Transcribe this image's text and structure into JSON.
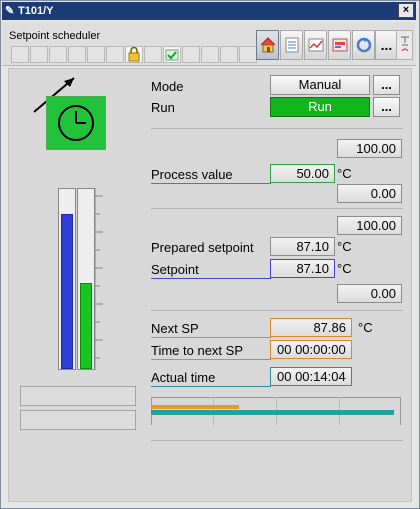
{
  "window": {
    "title": "T101/Y",
    "close_label": "×"
  },
  "panel": {
    "label": "Setpoint scheduler",
    "more_label": "..."
  },
  "operation": {
    "mode_label": "Mode",
    "mode_value": "Manual",
    "mode_more": "...",
    "run_label": "Run",
    "run_value": "Run",
    "run_more": "..."
  },
  "process": {
    "high_limit": "100.00",
    "pv_label": "Process value",
    "pv_value": "50.00",
    "pv_unit": "°C",
    "low_limit": "0.00"
  },
  "setpoints": {
    "high_limit": "100.00",
    "prepared_label": "Prepared setpoint",
    "prepared_value": "87.10",
    "prepared_unit": "°C",
    "sp_label": "Setpoint",
    "sp_value": "87.10",
    "sp_unit": "°C",
    "low_limit": "0.00"
  },
  "schedule": {
    "next_sp_label": "Next SP",
    "next_sp_value": "87.86",
    "next_sp_unit": "°C",
    "time_next_label": "Time to next SP",
    "time_next_value": "00  00:00:00",
    "actual_label": "Actual time",
    "actual_value": "00  00:14:04",
    "progress_orange": 0.35,
    "progress_teal": 0.97
  },
  "bars": {
    "blue_level": 0.86,
    "green_level": 0.48
  },
  "colors": {
    "pv": "#2e9e45",
    "sp": "#3a48d4",
    "next_sp": "#d48a2c",
    "actual": "#2e8b9a",
    "run": "#12b51c",
    "clock_bg": "#22c33a",
    "bar_blue": "#2f3fd6",
    "bar_green": "#19c51f"
  },
  "icons": [
    "pen-icon",
    "lock-icon",
    "checkmark-icon",
    "home-icon",
    "checklist-icon",
    "trend-icon",
    "faceplate-icon",
    "loop-icon",
    "pin-icon"
  ]
}
